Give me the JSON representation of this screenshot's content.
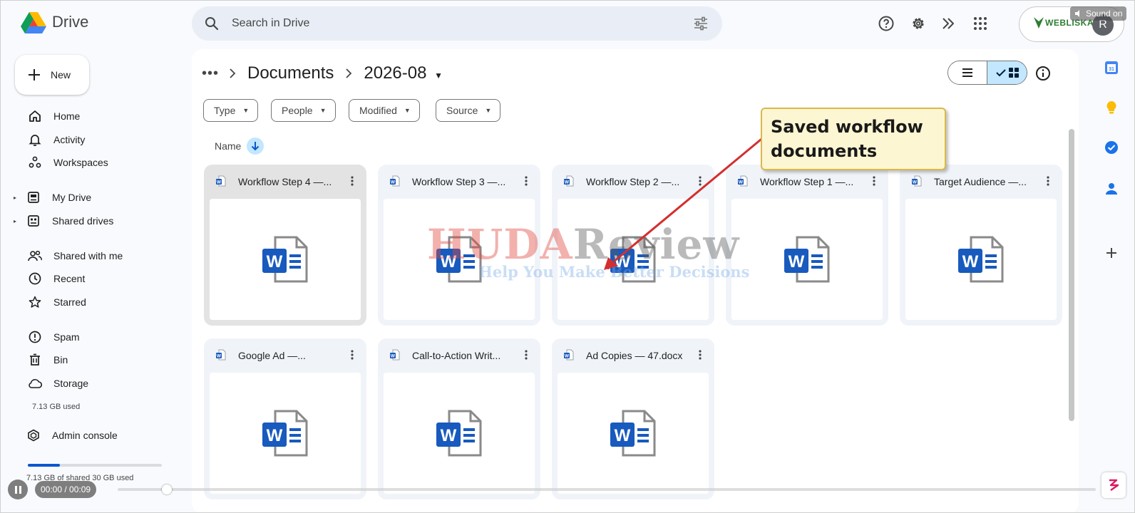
{
  "app": {
    "name": "Drive"
  },
  "search": {
    "placeholder": "Search in Drive"
  },
  "account": {
    "brand": "WEBLISKA",
    "avatar_initial": "R"
  },
  "overlay": {
    "sound_label": "Sound on"
  },
  "sidebar": {
    "new_label": "New",
    "items": [
      {
        "label": "Home",
        "icon": "home-icon"
      },
      {
        "label": "Activity",
        "icon": "bell-icon"
      },
      {
        "label": "Workspaces",
        "icon": "workspaces-icon"
      },
      {
        "label": "My Drive",
        "icon": "my-drive-icon",
        "expandable": true
      },
      {
        "label": "Shared drives",
        "icon": "shared-drives-icon",
        "expandable": true
      },
      {
        "label": "Shared with me",
        "icon": "people-icon"
      },
      {
        "label": "Recent",
        "icon": "clock-icon"
      },
      {
        "label": "Starred",
        "icon": "star-icon"
      },
      {
        "label": "Spam",
        "icon": "spam-icon"
      },
      {
        "label": "Bin",
        "icon": "trash-icon"
      },
      {
        "label": "Storage",
        "icon": "cloud-icon"
      },
      {
        "label": "Admin console",
        "icon": "admin-icon"
      }
    ],
    "storage_used": "7.13 GB used",
    "storage_summary": "7.13 GB of shared 30 GB used",
    "storage_fraction": 0.2377
  },
  "breadcrumb": {
    "items": [
      "Documents",
      "2026-08"
    ]
  },
  "filters": [
    "Type",
    "People",
    "Modified",
    "Source"
  ],
  "sort": {
    "label": "Name"
  },
  "files": [
    {
      "title": "Workflow Step 4 —...",
      "selected": true
    },
    {
      "title": "Workflow Step 3 —..."
    },
    {
      "title": "Workflow Step 2 —..."
    },
    {
      "title": "Workflow Step 1 —..."
    },
    {
      "title": "Target Audience —..."
    },
    {
      "title": "Google Ad —..."
    },
    {
      "title": "Call-to-Action Writ..."
    },
    {
      "title": "Ad Copies — 47.docx"
    }
  ],
  "annotation": {
    "text_line1": "Saved workflow",
    "text_line2": "documents"
  },
  "watermark": {
    "part1": "HUDA",
    "part2": "Review",
    "tagline": "Help You Make Better Decisions"
  },
  "video": {
    "time": "00:00 / 00:09",
    "progress": 0.0
  },
  "colors": {
    "accent": "#0b57d0",
    "selected_chip": "#c2e7ff",
    "callout_bg": "#fdf6d2",
    "arrow": "#d32f2f",
    "word_blue": "#185abd"
  }
}
